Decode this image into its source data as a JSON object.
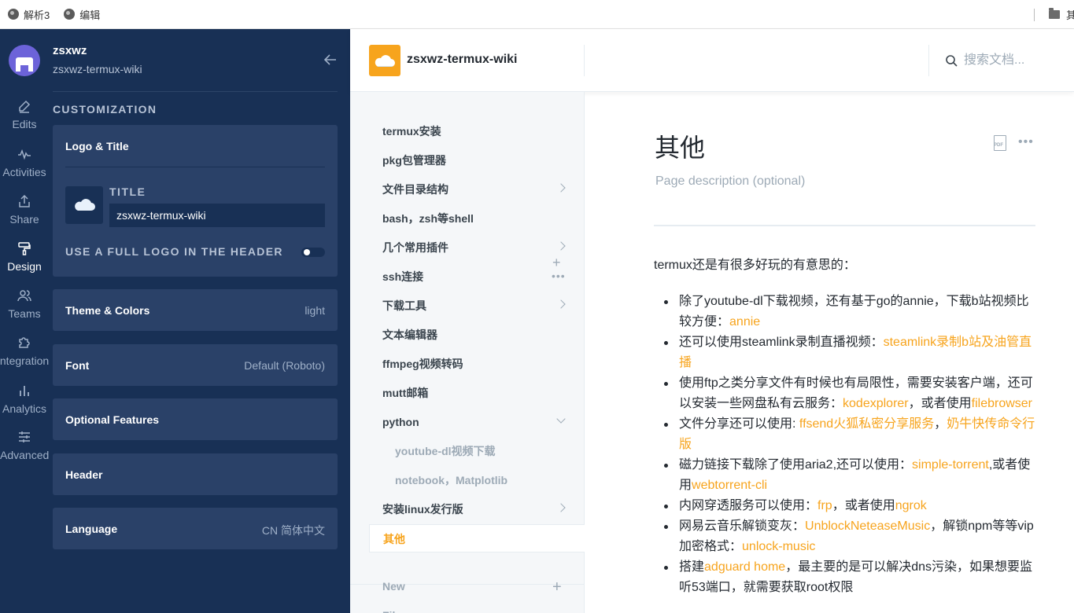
{
  "bookmarks": {
    "items": [
      {
        "label": "解析3",
        "icon": "globe-icon"
      },
      {
        "label": "编辑",
        "icon": "globe-icon"
      }
    ],
    "folder_label": "其"
  },
  "rail": {
    "items": [
      {
        "label": "Edits",
        "icon": "pencil-icon"
      },
      {
        "label": "Activities",
        "icon": "activity-icon"
      },
      {
        "label": "Share",
        "icon": "share-icon"
      },
      {
        "label": "Design",
        "icon": "paint-roller-icon"
      },
      {
        "label": "Teams",
        "icon": "users-icon"
      },
      {
        "label": "Integrations",
        "icon": "puzzle-icon"
      },
      {
        "label": "Analytics",
        "icon": "bar-chart-icon"
      },
      {
        "label": "Advanced",
        "icon": "sliders-icon"
      }
    ],
    "active": "Design"
  },
  "panel": {
    "org_name": "zsxwz",
    "org_sub": "zsxwz-termux-wiki",
    "section": "CUSTOMIZATION",
    "logo_title": {
      "title": "Logo & Title",
      "title_label": "TITLE",
      "title_value": "zsxwz-termux-wiki",
      "full_logo_label": "USE A FULL LOGO IN THE HEADER"
    },
    "theme": {
      "title": "Theme & Colors",
      "value": "light"
    },
    "font": {
      "title": "Font",
      "value": "Default (Roboto)"
    },
    "optional": {
      "title": "Optional Features"
    },
    "header": {
      "title": "Header"
    },
    "language": {
      "title": "Language",
      "value": "CN 简体中文"
    }
  },
  "topbar": {
    "space_name": "zsxwz-termux-wiki",
    "search_placeholder": "搜索文档..."
  },
  "toc": {
    "items": [
      {
        "label": "termux安装"
      },
      {
        "label": "pkg包管理器"
      },
      {
        "label": "文件目录结构"
      },
      {
        "label": "bash，zsh等shell"
      },
      {
        "label": "几个常用插件"
      },
      {
        "label": "ssh连接"
      },
      {
        "label": "下载工具"
      },
      {
        "label": "文本编辑器"
      },
      {
        "label": "ffmpeg视频转码"
      },
      {
        "label": "mutt邮箱"
      },
      {
        "label": "python"
      },
      {
        "label": "youtube-dl视频下载"
      },
      {
        "label": "notebook，Matplotlib"
      },
      {
        "label": "安装linux发行版"
      },
      {
        "label": "其他"
      }
    ],
    "new_label": "New",
    "file_label": "File"
  },
  "page": {
    "title": "其他",
    "description_placeholder": "Page description (optional)",
    "intro": "termux还是有很多好玩的有意思的：",
    "list": [
      {
        "parts": [
          {
            "t": "除了youtube-dl下载视频，还有基于go的annie，下载b站视频比较方便："
          },
          {
            "t": "annie",
            "link": true
          }
        ]
      },
      {
        "parts": [
          {
            "t": "还可以使用steamlink录制直播视频："
          },
          {
            "t": "steamlink录制b站及油管直播",
            "link": true
          }
        ]
      },
      {
        "parts": [
          {
            "t": "使用ftp之类分享文件有时候也有局限性，需要安装客户端，还可以安装一些网盘私有云服务："
          },
          {
            "t": "kodexplorer",
            "link": true
          },
          {
            "t": "，或者使用"
          },
          {
            "t": "filebrowser",
            "link": true
          }
        ]
      },
      {
        "parts": [
          {
            "t": "文件分享还可以使用: "
          },
          {
            "t": "ffsend火狐私密分享服务",
            "link": true
          },
          {
            "t": "，"
          },
          {
            "t": "奶牛快传命令行版",
            "link": true
          }
        ]
      },
      {
        "parts": [
          {
            "t": "磁力链接下载除了使用aria2,还可以使用："
          },
          {
            "t": "simple-torrent",
            "link": true
          },
          {
            "t": ",或者使用"
          },
          {
            "t": "webtorrent-cli",
            "link": true
          }
        ]
      },
      {
        "parts": [
          {
            "t": "内网穿透服务可以使用："
          },
          {
            "t": "frp",
            "link": true
          },
          {
            "t": "，或者使用"
          },
          {
            "t": "ngrok",
            "link": true
          }
        ]
      },
      {
        "parts": [
          {
            "t": "网易云音乐解锁变灰："
          },
          {
            "t": "UnblockNeteaseMusic",
            "link": true
          },
          {
            "t": "，解锁npm等等vip加密格式："
          },
          {
            "t": "unlock-music",
            "link": true
          }
        ]
      },
      {
        "parts": [
          {
            "t": "搭建"
          },
          {
            "t": "adguard home",
            "link": true
          },
          {
            "t": "，最主要的是可以解决dns污染，如果想要监听53端口，就需要获取root权限"
          }
        ]
      }
    ]
  },
  "colors": {
    "sidebar": "#183055",
    "card": "#2a4168",
    "accent": "#f7a41d"
  }
}
